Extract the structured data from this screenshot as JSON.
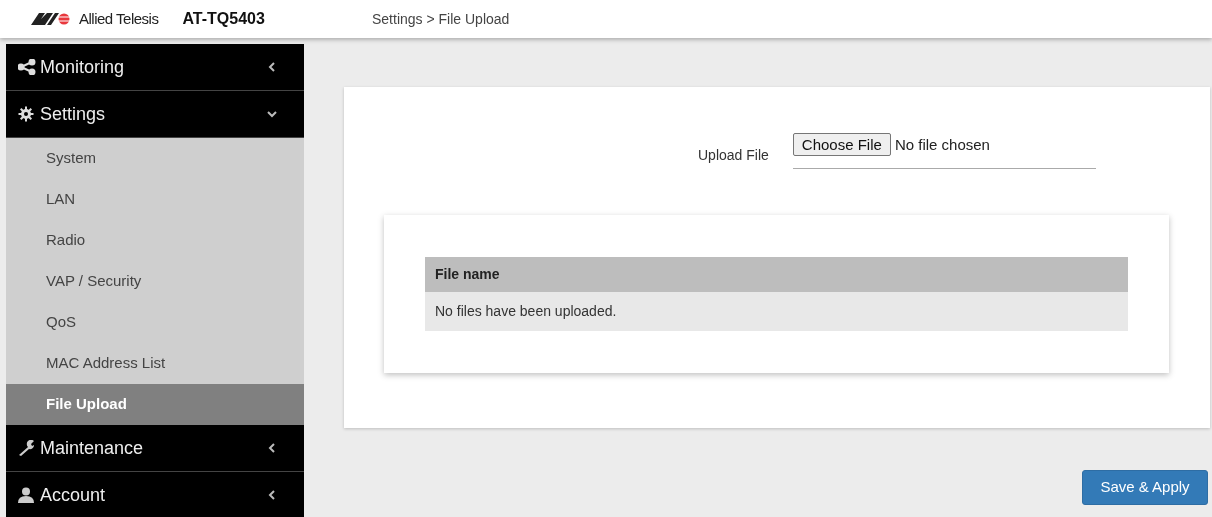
{
  "header": {
    "brand": "Allied Telesis",
    "model": "AT-TQ5403",
    "breadcrumb": "Settings > File Upload"
  },
  "sidebar": {
    "items": [
      {
        "label": "Monitoring",
        "expanded": false
      },
      {
        "label": "Settings",
        "expanded": true,
        "children": [
          {
            "label": "System",
            "selected": false
          },
          {
            "label": "LAN",
            "selected": false
          },
          {
            "label": "Radio",
            "selected": false
          },
          {
            "label": "VAP / Security",
            "selected": false
          },
          {
            "label": "QoS",
            "selected": false
          },
          {
            "label": "MAC Address List",
            "selected": false
          },
          {
            "label": "File Upload",
            "selected": true
          }
        ]
      },
      {
        "label": "Maintenance",
        "expanded": false
      },
      {
        "label": "Account",
        "expanded": false
      }
    ]
  },
  "upload": {
    "label": "Upload File",
    "button": "Choose File",
    "status": "No file chosen"
  },
  "table": {
    "columns": [
      "File name"
    ],
    "rows": [
      [
        "No files have been uploaded."
      ]
    ]
  },
  "save_button": "Save & Apply"
}
